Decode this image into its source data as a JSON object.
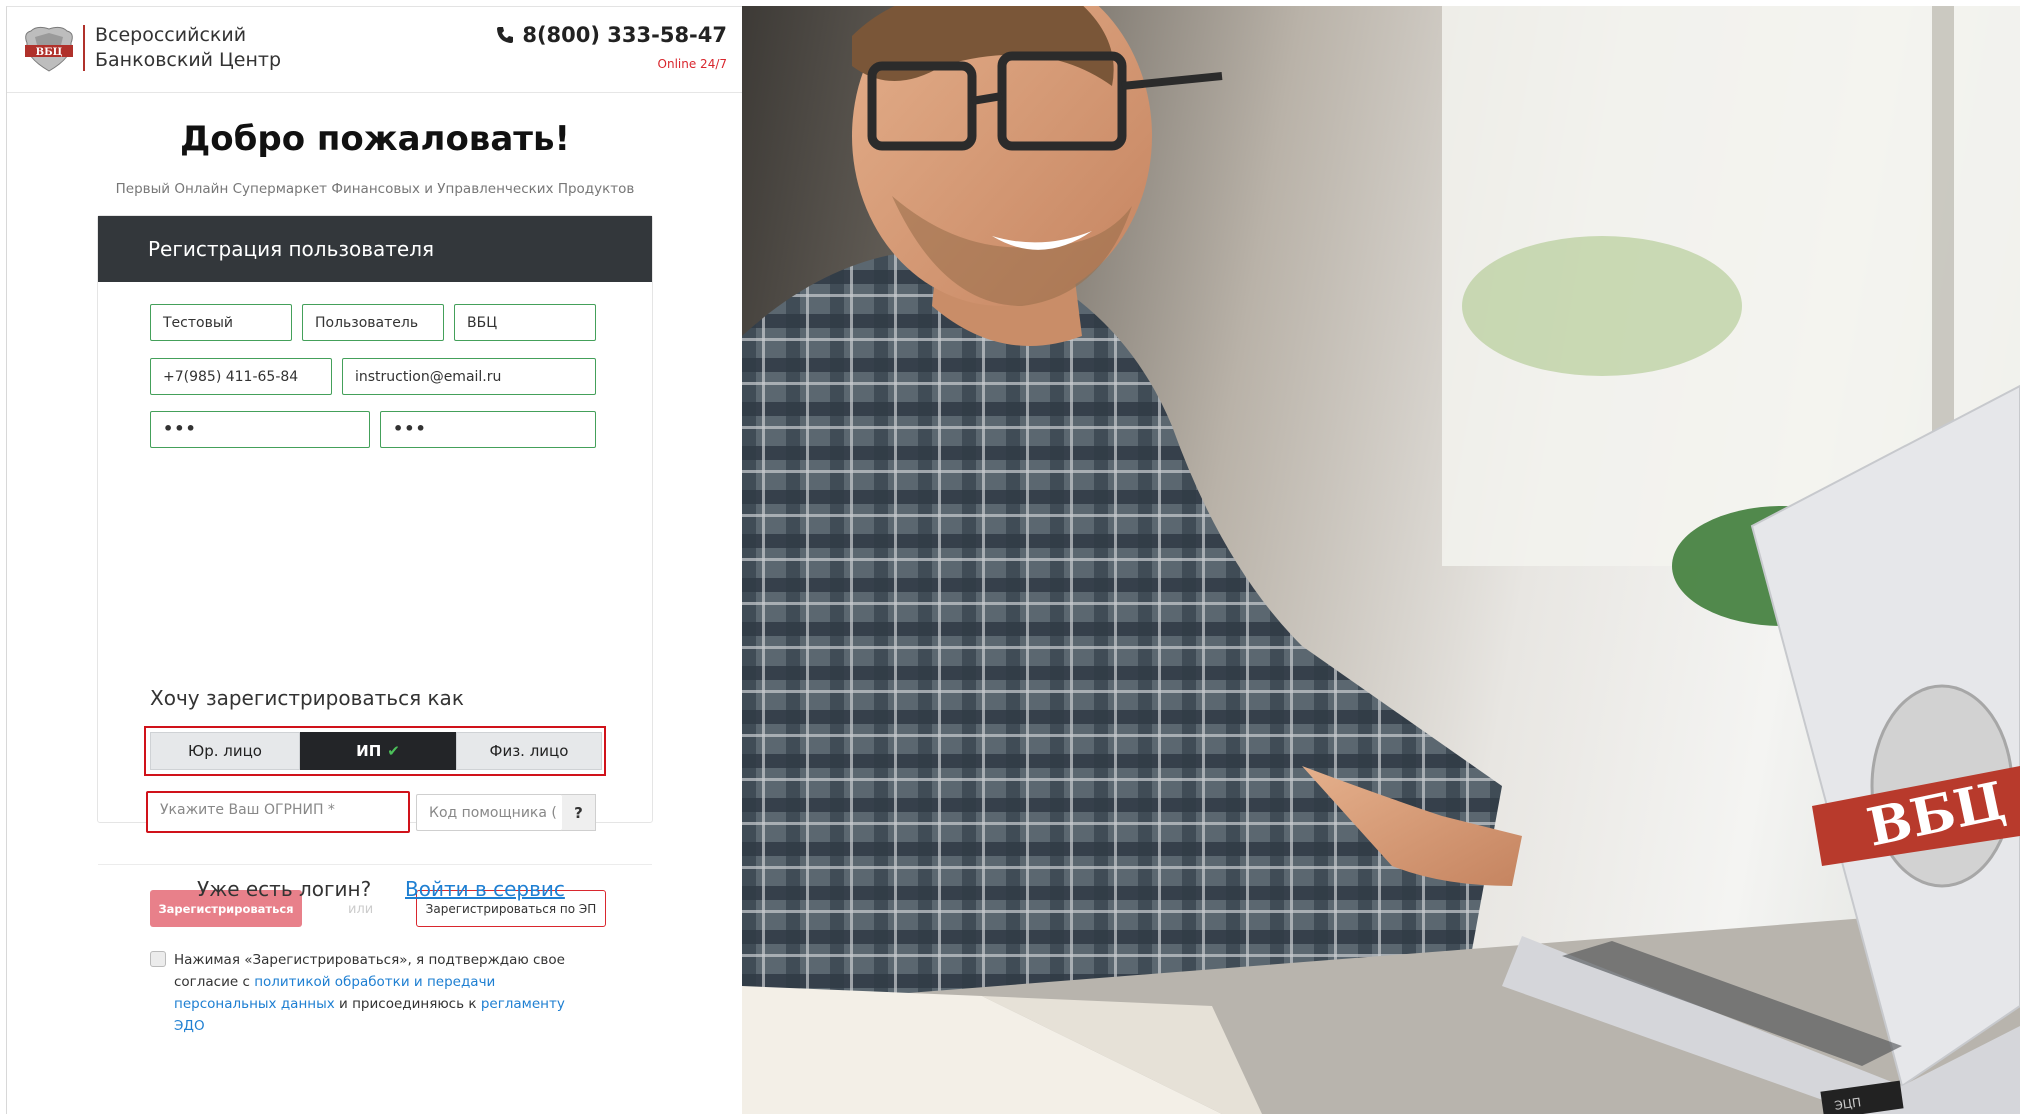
{
  "header": {
    "brand_line1": "Всероссийский",
    "brand_line2": "Банковский Центр",
    "phone": "8(800) 333-58-47",
    "online": "Online 24/7",
    "logo_text": "ВБЦ"
  },
  "welcome": {
    "title": "Добро пожаловать!",
    "subtitle": "Первый Онлайн Супермаркет Финансовых и Управленческих Продуктов"
  },
  "form": {
    "heading": "Регистрация пользователя",
    "last_name": "Тестовый",
    "first_name": "Пользователь",
    "middle_name": "ВБЦ",
    "phone": "+7(985) 411-65-84",
    "email": "instruction@email.ru",
    "password": "•••",
    "password_confirm": "•••",
    "register_as_label": "Хочу зарегистрироваться как",
    "types": [
      {
        "label": "Юр. лицо",
        "active": false
      },
      {
        "label": "ИП",
        "active": true
      },
      {
        "label": "Физ. лицо",
        "active": false
      }
    ],
    "ogrnip_placeholder": "Укажите Ваш ОГРНИП *",
    "helper_code_placeholder": "Код помощника (",
    "help_label": "?",
    "register_button": "Зарегистрироваться",
    "or_label": "или",
    "register_ep_button": "Зарегистрироваться по ЭП",
    "agree_text_1": "Нажимая «Зарегистрироваться», я подтверждаю свое согласие с ",
    "agree_link_1": "политикой обработки и передачи персональных данных",
    "agree_text_2": " и присоединяюсь к ",
    "agree_link_2": "регламенту ЭДО"
  },
  "footer": {
    "already_text": "Уже есть логин?",
    "login_link": "Войти в сервис"
  },
  "photo": {
    "laptop_logo_text": "ВБЦ",
    "book_stamp_text": "ЭЦП"
  },
  "colors": {
    "accent_red": "#d9272e",
    "header_dark": "#33373b",
    "valid_green": "#44a05a",
    "link_blue": "#1e7fd2",
    "register_pink": "#e8808a"
  }
}
